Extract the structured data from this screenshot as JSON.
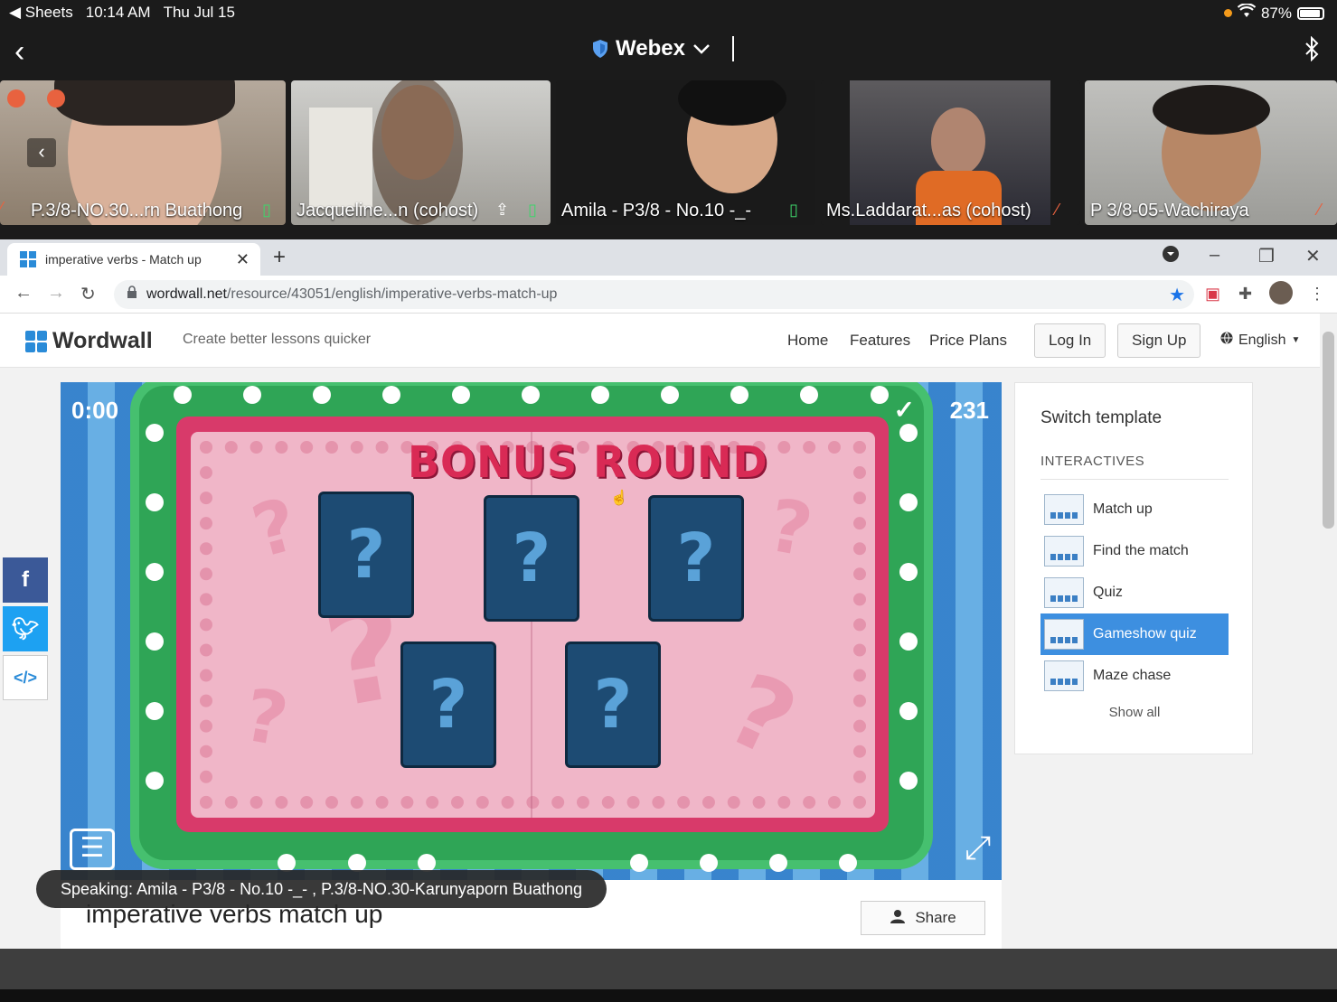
{
  "status_bar": {
    "back_app": "◀ Sheets",
    "time": "10:14 AM",
    "date": "Thu Jul 15",
    "battery": "87%"
  },
  "webex": {
    "title": "Webex"
  },
  "participants": [
    {
      "name": "P.3/8-NO.30...rn Buathong"
    },
    {
      "name": "Jacqueline...n (cohost)"
    },
    {
      "name": "Amila - P3/8 - No.10 -_-"
    },
    {
      "name": "Ms.Laddarat...as (cohost)"
    },
    {
      "name": "P 3/8-05-Wachiraya"
    }
  ],
  "browser": {
    "tab_title": "imperative verbs - Match up",
    "url_host": "wordwall.net",
    "url_path": "/resource/43051/english/imperative-verbs-match-up"
  },
  "wordwall": {
    "brand": "Wordwall",
    "tagline": "Create better lessons quicker",
    "nav": {
      "home": "Home",
      "features": "Features",
      "price_plans": "Price Plans"
    },
    "login": "Log In",
    "signup": "Sign Up",
    "language": "English"
  },
  "game": {
    "timer": "0:00",
    "score": "231",
    "banner": "BONUS ROUND",
    "card_symbol": "?"
  },
  "activity": {
    "title": "imperative verbs match up",
    "share": "Share"
  },
  "switch_template": {
    "title": "Switch template",
    "section": "INTERACTIVES",
    "items": [
      "Match up",
      "Find the match",
      "Quiz",
      "Gameshow quiz",
      "Maze chase"
    ],
    "selected": "Gameshow quiz",
    "show_all": "Show all"
  },
  "speaking": "Speaking: Amila - P3/8 - No.10 -_- , P.3/8-NO.30-Karunyaporn Buathong",
  "colors": {
    "accent": "#3d8fe0",
    "facebook": "#3b5998",
    "twitter": "#1da1f2"
  }
}
